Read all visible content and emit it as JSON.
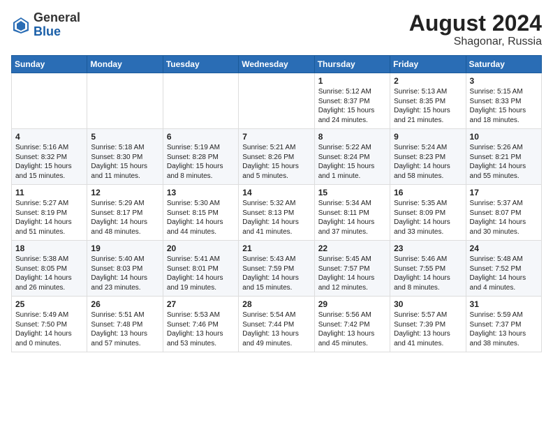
{
  "header": {
    "logo_general": "General",
    "logo_blue": "Blue",
    "title": "August 2024",
    "subtitle": "Shagonar, Russia"
  },
  "days_of_week": [
    "Sunday",
    "Monday",
    "Tuesday",
    "Wednesday",
    "Thursday",
    "Friday",
    "Saturday"
  ],
  "weeks": [
    [
      {
        "day": "",
        "info": ""
      },
      {
        "day": "",
        "info": ""
      },
      {
        "day": "",
        "info": ""
      },
      {
        "day": "",
        "info": ""
      },
      {
        "day": "1",
        "info": "Sunrise: 5:12 AM\nSunset: 8:37 PM\nDaylight: 15 hours\nand 24 minutes."
      },
      {
        "day": "2",
        "info": "Sunrise: 5:13 AM\nSunset: 8:35 PM\nDaylight: 15 hours\nand 21 minutes."
      },
      {
        "day": "3",
        "info": "Sunrise: 5:15 AM\nSunset: 8:33 PM\nDaylight: 15 hours\nand 18 minutes."
      }
    ],
    [
      {
        "day": "4",
        "info": "Sunrise: 5:16 AM\nSunset: 8:32 PM\nDaylight: 15 hours\nand 15 minutes."
      },
      {
        "day": "5",
        "info": "Sunrise: 5:18 AM\nSunset: 8:30 PM\nDaylight: 15 hours\nand 11 minutes."
      },
      {
        "day": "6",
        "info": "Sunrise: 5:19 AM\nSunset: 8:28 PM\nDaylight: 15 hours\nand 8 minutes."
      },
      {
        "day": "7",
        "info": "Sunrise: 5:21 AM\nSunset: 8:26 PM\nDaylight: 15 hours\nand 5 minutes."
      },
      {
        "day": "8",
        "info": "Sunrise: 5:22 AM\nSunset: 8:24 PM\nDaylight: 15 hours\nand 1 minute."
      },
      {
        "day": "9",
        "info": "Sunrise: 5:24 AM\nSunset: 8:23 PM\nDaylight: 14 hours\nand 58 minutes."
      },
      {
        "day": "10",
        "info": "Sunrise: 5:26 AM\nSunset: 8:21 PM\nDaylight: 14 hours\nand 55 minutes."
      }
    ],
    [
      {
        "day": "11",
        "info": "Sunrise: 5:27 AM\nSunset: 8:19 PM\nDaylight: 14 hours\nand 51 minutes."
      },
      {
        "day": "12",
        "info": "Sunrise: 5:29 AM\nSunset: 8:17 PM\nDaylight: 14 hours\nand 48 minutes."
      },
      {
        "day": "13",
        "info": "Sunrise: 5:30 AM\nSunset: 8:15 PM\nDaylight: 14 hours\nand 44 minutes."
      },
      {
        "day": "14",
        "info": "Sunrise: 5:32 AM\nSunset: 8:13 PM\nDaylight: 14 hours\nand 41 minutes."
      },
      {
        "day": "15",
        "info": "Sunrise: 5:34 AM\nSunset: 8:11 PM\nDaylight: 14 hours\nand 37 minutes."
      },
      {
        "day": "16",
        "info": "Sunrise: 5:35 AM\nSunset: 8:09 PM\nDaylight: 14 hours\nand 33 minutes."
      },
      {
        "day": "17",
        "info": "Sunrise: 5:37 AM\nSunset: 8:07 PM\nDaylight: 14 hours\nand 30 minutes."
      }
    ],
    [
      {
        "day": "18",
        "info": "Sunrise: 5:38 AM\nSunset: 8:05 PM\nDaylight: 14 hours\nand 26 minutes."
      },
      {
        "day": "19",
        "info": "Sunrise: 5:40 AM\nSunset: 8:03 PM\nDaylight: 14 hours\nand 23 minutes."
      },
      {
        "day": "20",
        "info": "Sunrise: 5:41 AM\nSunset: 8:01 PM\nDaylight: 14 hours\nand 19 minutes."
      },
      {
        "day": "21",
        "info": "Sunrise: 5:43 AM\nSunset: 7:59 PM\nDaylight: 14 hours\nand 15 minutes."
      },
      {
        "day": "22",
        "info": "Sunrise: 5:45 AM\nSunset: 7:57 PM\nDaylight: 14 hours\nand 12 minutes."
      },
      {
        "day": "23",
        "info": "Sunrise: 5:46 AM\nSunset: 7:55 PM\nDaylight: 14 hours\nand 8 minutes."
      },
      {
        "day": "24",
        "info": "Sunrise: 5:48 AM\nSunset: 7:52 PM\nDaylight: 14 hours\nand 4 minutes."
      }
    ],
    [
      {
        "day": "25",
        "info": "Sunrise: 5:49 AM\nSunset: 7:50 PM\nDaylight: 14 hours\nand 0 minutes."
      },
      {
        "day": "26",
        "info": "Sunrise: 5:51 AM\nSunset: 7:48 PM\nDaylight: 13 hours\nand 57 minutes."
      },
      {
        "day": "27",
        "info": "Sunrise: 5:53 AM\nSunset: 7:46 PM\nDaylight: 13 hours\nand 53 minutes."
      },
      {
        "day": "28",
        "info": "Sunrise: 5:54 AM\nSunset: 7:44 PM\nDaylight: 13 hours\nand 49 minutes."
      },
      {
        "day": "29",
        "info": "Sunrise: 5:56 AM\nSunset: 7:42 PM\nDaylight: 13 hours\nand 45 minutes."
      },
      {
        "day": "30",
        "info": "Sunrise: 5:57 AM\nSunset: 7:39 PM\nDaylight: 13 hours\nand 41 minutes."
      },
      {
        "day": "31",
        "info": "Sunrise: 5:59 AM\nSunset: 7:37 PM\nDaylight: 13 hours\nand 38 minutes."
      }
    ]
  ]
}
